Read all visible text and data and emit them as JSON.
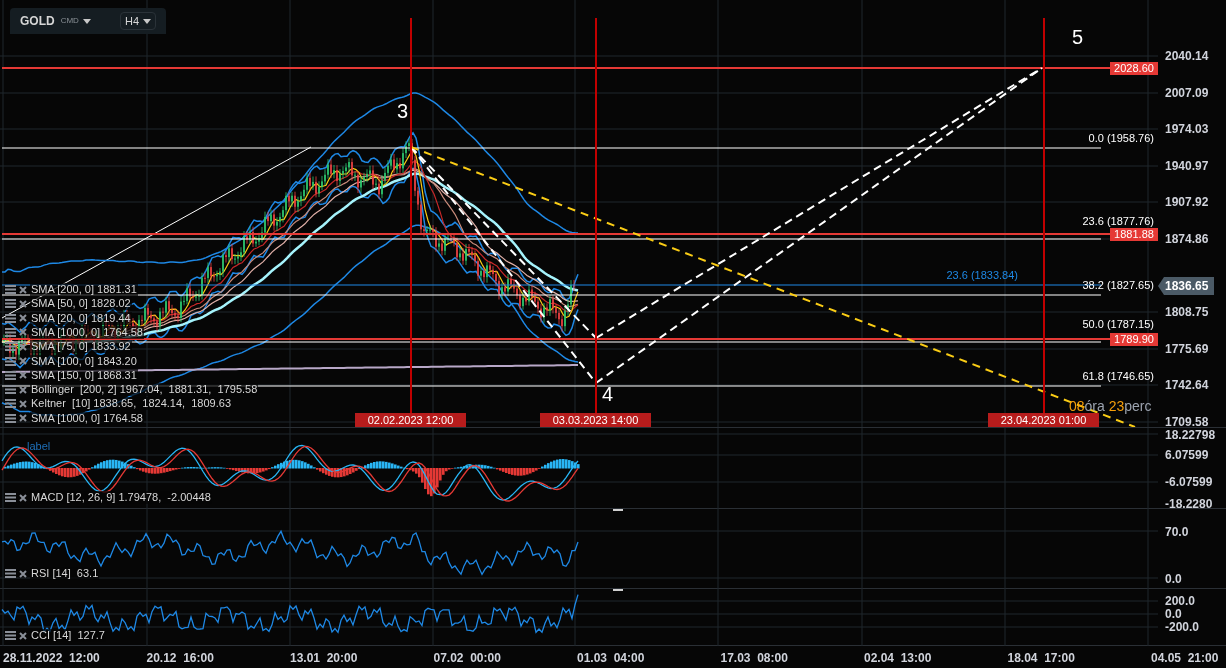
{
  "toolbar": {
    "symbol": "GOLD",
    "market": "CMD",
    "timeframe": "H4"
  },
  "price_axis": {
    "ticks": [
      "2040.14",
      "2007.09",
      "1974.03",
      "1940.97",
      "1907.92",
      "1874.86",
      "1808.75",
      "1775.69",
      "1742.64",
      "1709.58"
    ],
    "current_price": "1836.65"
  },
  "price_levels": [
    "2028.60",
    "1881.88",
    "1789.90"
  ],
  "fib_levels": [
    {
      "label": "0.0 (1958.76)",
      "color": "#ffffff"
    },
    {
      "label": "23.6 (1877.76)",
      "color": "#ffffff"
    },
    {
      "label": "23.6 (1833.84)",
      "color": "#1e88e5"
    },
    {
      "label": "38.2 (1827.65)",
      "color": "#ffffff"
    },
    {
      "label": "50.0 (1787.15)",
      "color": "#ffffff"
    },
    {
      "label": "61.8 (1746.65)",
      "color": "#ffffff"
    }
  ],
  "time_markers": [
    "02.02.2023 12:00",
    "03.03.2023 14:00",
    "23.04.2023 01:00"
  ],
  "wave_labels": [
    "3",
    "4",
    "5"
  ],
  "countdown": [
    {
      "value": "08",
      "unit": "óra"
    },
    {
      "value": "23",
      "unit": "perc"
    }
  ],
  "indicators": [
    "SMA [200, 0] 1881.31",
    "SMA [50, 0] 1828.02",
    "SMA [20, 0] 1819.44",
    "SMA [1000, 0] 1764.58",
    "SMA [75, 0] 1833.92",
    "SMA [100, 0] 1843.20",
    "SMA [150, 0] 1868.31",
    "Bollinger  [200, 2] 1967.04,  1881.31,  1795.58",
    "Keltner  [10] 1838.65,  1824.14,  1809.63",
    "SMA [1000, 0] 1764.58"
  ],
  "macd": {
    "tag": "label",
    "legend": "MACD [12, 26, 9] 1.79478,  -2.00448",
    "ticks": [
      "18.22798",
      "6.07599",
      "-6.07599",
      "-18.2280"
    ]
  },
  "rsi": {
    "legend": "RSI [14]  63.1",
    "ticks": [
      "70.0",
      "0.0"
    ]
  },
  "cci": {
    "legend": "CCI [14]  127.7",
    "ticks": [
      "200.0",
      "0.0",
      "-200.0"
    ]
  },
  "time_axis": [
    "28.11.2022  12:00",
    "20.12  16:00",
    "13.01  20:00",
    "07.02  00:00",
    "01.03  04:00",
    "17.03  08:00",
    "02.04  13:00",
    "18.04  17:00",
    "04.05  21:00"
  ]
}
